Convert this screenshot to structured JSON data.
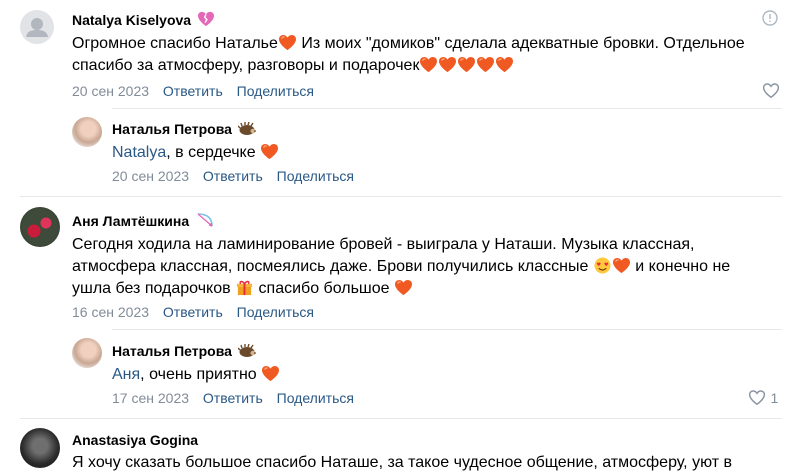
{
  "colors": {
    "link": "#2a5885",
    "meta": "#818c99",
    "heart": "#f05a22",
    "separator": "#e7e8ec"
  },
  "comments": [
    {
      "author": "Natalya Kiselyova",
      "badge": "broken-heart-icon",
      "text_line1": "Огромное спасибо Наталье",
      "text_line1b": " Из моих \"домиков\" сделала адекватные бровки. Отдельное",
      "text_line2": "спасибо за атмосферу, разговоры и подарочек",
      "date": "20 сен 2023",
      "reply": "Ответить",
      "share": "Поделиться",
      "likes": ""
    },
    {
      "author": "Наталья Петрова",
      "badge": "hedgehog-icon",
      "mention": "Natalya",
      "text": ", в сердечке ",
      "date": "20 сен 2023",
      "reply": "Ответить",
      "share": "Поделиться"
    },
    {
      "author": "Аня Ламтёшкина",
      "badge": "bow-arrow-icon",
      "text_line1": "Сегодня ходила на ламинирование бровей - выиграла у Наташи. Музыка классная,",
      "text_line2a": "атмосфера классная, посмеялись даже. Брови получились классные ",
      "text_line2b": " и конечно не",
      "text_line3a": "ушла без подарочков ",
      "text_line3b": " спасибо большое ",
      "date": "16 сен 2023",
      "reply": "Ответить",
      "share": "Поделиться"
    },
    {
      "author": "Наталья Петрова",
      "badge": "hedgehog-icon",
      "mention": "Аня",
      "text": ", очень приятно ",
      "date": "17 сен 2023",
      "reply": "Ответить",
      "share": "Поделиться",
      "likes": "1"
    },
    {
      "author": "Anastasiya Gogina",
      "text_line1": "Я хочу сказать большое спасибо Наташе, за такое чудесное общение, атмосферу, уют в"
    }
  ]
}
